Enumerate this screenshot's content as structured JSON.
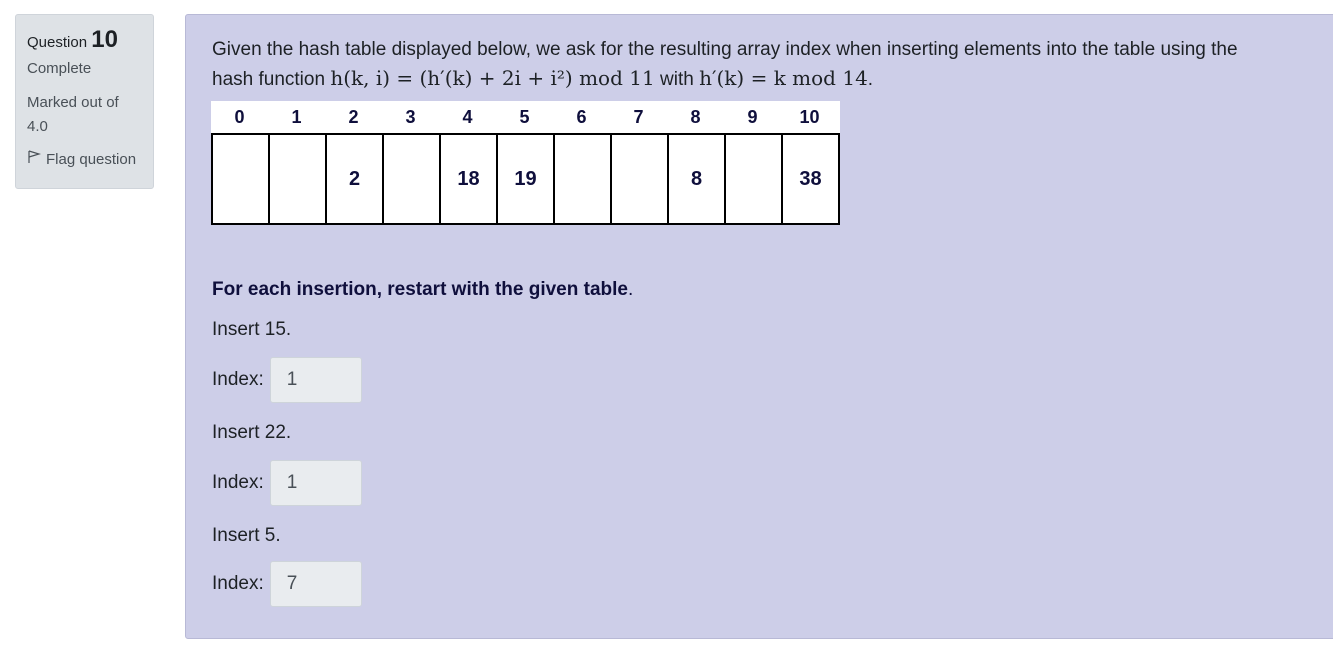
{
  "info": {
    "question_label": "Question",
    "question_number": "10",
    "state": "Complete",
    "grade": "Marked out of 4.0",
    "flag_label": "Flag question"
  },
  "question": {
    "intro": "Given the hash table displayed below, we ask for the resulting array index when inserting elements into the table using the",
    "hash_prefix": "hash function",
    "hash_formula": "h(k, i) = (h′(k) + 2i + i²)   mod  11",
    "with_label": "with",
    "aux_formula": "h′(k) = k   mod  14",
    "period": ".",
    "table": {
      "indices": [
        "0",
        "1",
        "2",
        "3",
        "4",
        "5",
        "6",
        "7",
        "8",
        "9",
        "10"
      ],
      "values": [
        "",
        "",
        "2",
        "",
        "18",
        "19",
        "",
        "",
        "8",
        "",
        "38"
      ]
    },
    "instruction_bold": "For each insertion, restart with the given table",
    "instruction_end": ".",
    "parts": [
      {
        "prompt": "Insert 15.",
        "index_label": "Index:",
        "answer": "1"
      },
      {
        "prompt": "Insert 22.",
        "index_label": "Index:",
        "answer": "1"
      },
      {
        "prompt": "Insert 5.",
        "index_label": "Index:",
        "answer": "7"
      }
    ]
  },
  "colors": {
    "content_bg": "#cdcee8",
    "info_bg": "#dee2e6",
    "input_bg": "#e9ecef"
  }
}
